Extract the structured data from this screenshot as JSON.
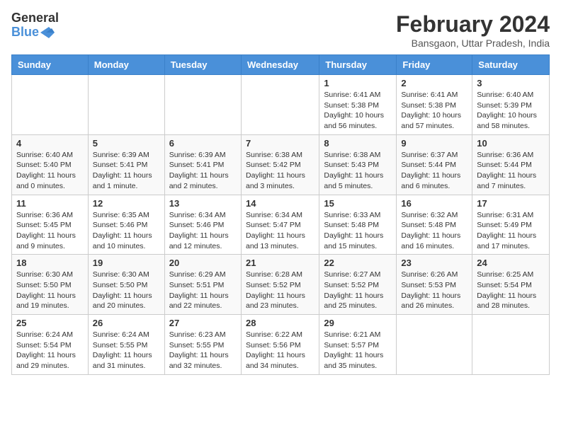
{
  "header": {
    "logo_line1": "General",
    "logo_line2": "Blue",
    "month_year": "February 2024",
    "location": "Bansgaon, Uttar Pradesh, India"
  },
  "days_of_week": [
    "Sunday",
    "Monday",
    "Tuesday",
    "Wednesday",
    "Thursday",
    "Friday",
    "Saturday"
  ],
  "weeks": [
    [
      {
        "day": "",
        "info": ""
      },
      {
        "day": "",
        "info": ""
      },
      {
        "day": "",
        "info": ""
      },
      {
        "day": "",
        "info": ""
      },
      {
        "day": "1",
        "info": "Sunrise: 6:41 AM\nSunset: 5:38 PM\nDaylight: 10 hours\nand 56 minutes."
      },
      {
        "day": "2",
        "info": "Sunrise: 6:41 AM\nSunset: 5:38 PM\nDaylight: 10 hours\nand 57 minutes."
      },
      {
        "day": "3",
        "info": "Sunrise: 6:40 AM\nSunset: 5:39 PM\nDaylight: 10 hours\nand 58 minutes."
      }
    ],
    [
      {
        "day": "4",
        "info": "Sunrise: 6:40 AM\nSunset: 5:40 PM\nDaylight: 11 hours\nand 0 minutes."
      },
      {
        "day": "5",
        "info": "Sunrise: 6:39 AM\nSunset: 5:41 PM\nDaylight: 11 hours\nand 1 minute."
      },
      {
        "day": "6",
        "info": "Sunrise: 6:39 AM\nSunset: 5:41 PM\nDaylight: 11 hours\nand 2 minutes."
      },
      {
        "day": "7",
        "info": "Sunrise: 6:38 AM\nSunset: 5:42 PM\nDaylight: 11 hours\nand 3 minutes."
      },
      {
        "day": "8",
        "info": "Sunrise: 6:38 AM\nSunset: 5:43 PM\nDaylight: 11 hours\nand 5 minutes."
      },
      {
        "day": "9",
        "info": "Sunrise: 6:37 AM\nSunset: 5:44 PM\nDaylight: 11 hours\nand 6 minutes."
      },
      {
        "day": "10",
        "info": "Sunrise: 6:36 AM\nSunset: 5:44 PM\nDaylight: 11 hours\nand 7 minutes."
      }
    ],
    [
      {
        "day": "11",
        "info": "Sunrise: 6:36 AM\nSunset: 5:45 PM\nDaylight: 11 hours\nand 9 minutes."
      },
      {
        "day": "12",
        "info": "Sunrise: 6:35 AM\nSunset: 5:46 PM\nDaylight: 11 hours\nand 10 minutes."
      },
      {
        "day": "13",
        "info": "Sunrise: 6:34 AM\nSunset: 5:46 PM\nDaylight: 11 hours\nand 12 minutes."
      },
      {
        "day": "14",
        "info": "Sunrise: 6:34 AM\nSunset: 5:47 PM\nDaylight: 11 hours\nand 13 minutes."
      },
      {
        "day": "15",
        "info": "Sunrise: 6:33 AM\nSunset: 5:48 PM\nDaylight: 11 hours\nand 15 minutes."
      },
      {
        "day": "16",
        "info": "Sunrise: 6:32 AM\nSunset: 5:48 PM\nDaylight: 11 hours\nand 16 minutes."
      },
      {
        "day": "17",
        "info": "Sunrise: 6:31 AM\nSunset: 5:49 PM\nDaylight: 11 hours\nand 17 minutes."
      }
    ],
    [
      {
        "day": "18",
        "info": "Sunrise: 6:30 AM\nSunset: 5:50 PM\nDaylight: 11 hours\nand 19 minutes."
      },
      {
        "day": "19",
        "info": "Sunrise: 6:30 AM\nSunset: 5:50 PM\nDaylight: 11 hours\nand 20 minutes."
      },
      {
        "day": "20",
        "info": "Sunrise: 6:29 AM\nSunset: 5:51 PM\nDaylight: 11 hours\nand 22 minutes."
      },
      {
        "day": "21",
        "info": "Sunrise: 6:28 AM\nSunset: 5:52 PM\nDaylight: 11 hours\nand 23 minutes."
      },
      {
        "day": "22",
        "info": "Sunrise: 6:27 AM\nSunset: 5:52 PM\nDaylight: 11 hours\nand 25 minutes."
      },
      {
        "day": "23",
        "info": "Sunrise: 6:26 AM\nSunset: 5:53 PM\nDaylight: 11 hours\nand 26 minutes."
      },
      {
        "day": "24",
        "info": "Sunrise: 6:25 AM\nSunset: 5:54 PM\nDaylight: 11 hours\nand 28 minutes."
      }
    ],
    [
      {
        "day": "25",
        "info": "Sunrise: 6:24 AM\nSunset: 5:54 PM\nDaylight: 11 hours\nand 29 minutes."
      },
      {
        "day": "26",
        "info": "Sunrise: 6:24 AM\nSunset: 5:55 PM\nDaylight: 11 hours\nand 31 minutes."
      },
      {
        "day": "27",
        "info": "Sunrise: 6:23 AM\nSunset: 5:55 PM\nDaylight: 11 hours\nand 32 minutes."
      },
      {
        "day": "28",
        "info": "Sunrise: 6:22 AM\nSunset: 5:56 PM\nDaylight: 11 hours\nand 34 minutes."
      },
      {
        "day": "29",
        "info": "Sunrise: 6:21 AM\nSunset: 5:57 PM\nDaylight: 11 hours\nand 35 minutes."
      },
      {
        "day": "",
        "info": ""
      },
      {
        "day": "",
        "info": ""
      }
    ]
  ]
}
